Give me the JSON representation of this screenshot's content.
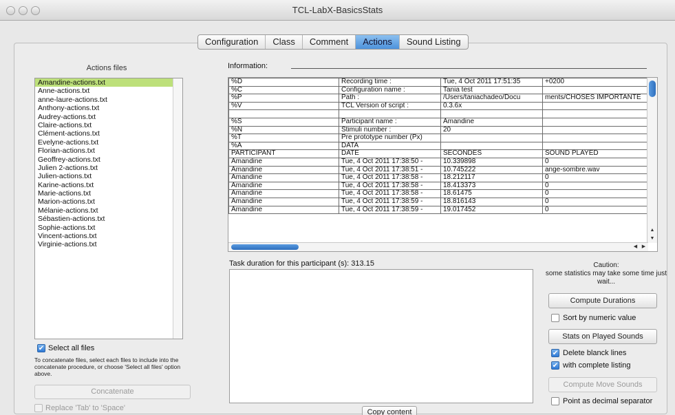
{
  "window": {
    "title": "TCL-LabX-BasicsStats"
  },
  "tabs": [
    {
      "label": "Configuration",
      "active": false
    },
    {
      "label": "Class",
      "active": false
    },
    {
      "label": "Comment",
      "active": false
    },
    {
      "label": "Actions",
      "active": true
    },
    {
      "label": "Sound Listing",
      "active": false
    }
  ],
  "files": {
    "title": "Actions files",
    "selected_index": 0,
    "items": [
      "Amandine-actions.txt",
      "Anne-actions.txt",
      "anne-laure-actions.txt",
      "Anthony-actions.txt",
      "Audrey-actions.txt",
      "Claire-actions.txt",
      "Clément-actions.txt",
      "Evelyne-actions.txt",
      "Florian-actions.txt",
      "Geoffrey-actions.txt",
      "Julien 2-actions.txt",
      "Julien-actions.txt",
      "Karine-actions.txt",
      "Marie-actions.txt",
      "Marion-actions.txt",
      "Mélanie-actions.txt",
      "Sébastien-actions.txt",
      "Sophie-actions.txt",
      "Vincent-actions.txt",
      "Virginie-actions.txt"
    ],
    "select_all_label": "Select all files",
    "select_all_checked": true,
    "concat_help": "To concatenate files, select each files to include into the concatenate procedure, or choose 'Select all files' option above.",
    "concatenate_label": "Concatenate",
    "replace_tab_label": "Replace 'Tab' to 'Space'"
  },
  "information": {
    "label": "Information:",
    "rows": [
      [
        "%D",
        "Recording time :",
        "Tue, 4 Oct 2011 17:51:35",
        "+0200"
      ],
      [
        "%C",
        "Configuration name :",
        "Tania test",
        ""
      ],
      [
        "%P",
        "Path :",
        "/Users/taniachadeo/Docu",
        "ments/CHOSES IMPORTANTE"
      ],
      [
        "%V",
        "TCL Version of script :",
        "0.3.6x",
        ""
      ],
      [
        "",
        "",
        "",
        ""
      ],
      [
        "%S",
        "Participant name :",
        "Amandine",
        ""
      ],
      [
        "%N",
        "Stimuli number :",
        "20",
        ""
      ],
      [
        "%T",
        "Pre prototype number (Px)",
        "",
        ""
      ],
      [
        "%A",
        "DATA",
        "",
        ""
      ],
      [
        "PARTICIPANT",
        "DATE",
        "SECONDES",
        "SOUND PLAYED"
      ],
      [
        "Amandine",
        "Tue, 4 Oct 2011 17:38:50 -",
        "10.339898",
        "0"
      ],
      [
        "Amandine",
        "Tue, 4 Oct 2011 17:38:51 -",
        "10.745222",
        "ange-sombre.wav"
      ],
      [
        "Amandine",
        "Tue, 4 Oct 2011 17:38:58 -",
        "18.212117",
        "0"
      ],
      [
        "Amandine",
        "Tue, 4 Oct 2011 17:38:58 -",
        "18.413373",
        "0"
      ],
      [
        "Amandine",
        "Tue, 4 Oct 2011 17:38:58 -",
        "18.61475",
        "0"
      ],
      [
        "Amandine",
        "Tue, 4 Oct 2011 17:38:59 -",
        "18.816143",
        "0"
      ],
      [
        "Amandine",
        "Tue, 4 Oct 2011 17:38:59 -",
        "19.017452",
        "0"
      ]
    ]
  },
  "task_duration": "Task duration for this participant (s): 313.15",
  "copy_content_label": "Copy content",
  "caution": {
    "title": "Caution:",
    "text": "some statistics may take some time just wait..."
  },
  "controls": {
    "compute_durations_label": "Compute Durations",
    "sort_numeric_label": "Sort by numeric value",
    "sort_numeric_checked": false,
    "stats_played_label": "Stats on Played Sounds",
    "delete_blank_label": "Delete blanck lines",
    "delete_blank_checked": true,
    "complete_listing_label": "with complete listing",
    "complete_listing_checked": true,
    "compute_move_label": "Compute Move Sounds",
    "decimal_sep_label": "Point as decimal separator",
    "decimal_sep_checked": false
  }
}
